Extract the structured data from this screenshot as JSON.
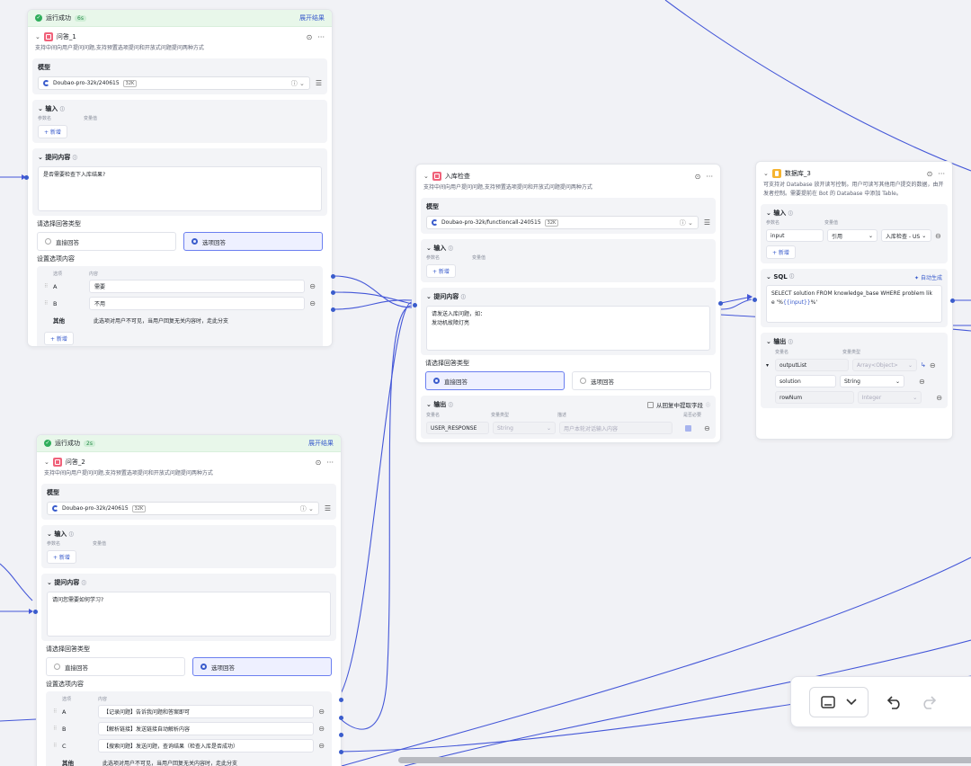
{
  "common": {
    "add_label": "+ 新增",
    "param_name_header": "参数名",
    "var_value_header": "变量值",
    "var_name_header": "变量名",
    "var_type_header": "变量类型",
    "model_label": "模型",
    "input_label": "输入",
    "prompt_label": "提问内容",
    "response_type_label": "请选择回答类型",
    "direct_answer": "直接回答",
    "option_answer": "选项回答",
    "option_content_label": "设置选项内容",
    "option_header": "选项",
    "content_header": "内容",
    "other_label": "其他",
    "other_desc": "此选项对用户不可见，当用户回复无关内容时，走此分支",
    "qa_desc": "支持中间向用户提问问题,支持预置选项提问和开放式问题提问两种方式"
  },
  "node_qa1": {
    "run_status": "运行成功",
    "run_time": "6s",
    "expand": "展开结果",
    "title": "问答_1",
    "model": "Doubao-pro-32k/240615",
    "model_ctx": "32K",
    "prompt": "是否需要检查下入库结果?",
    "options": [
      {
        "key": "A",
        "value": "需要"
      },
      {
        "key": "B",
        "value": "不用"
      }
    ]
  },
  "node_qa2": {
    "run_status": "运行成功",
    "run_time": "2s",
    "expand": "展开结果",
    "title": "问答_2",
    "model": "Doubao-pro-32k/240615",
    "model_ctx": "32K",
    "prompt": "请问您需要如何学习?",
    "options": [
      {
        "key": "A",
        "value": "【记录问题】告诉我问题和答案即可"
      },
      {
        "key": "B",
        "value": "【解析链接】发送链接自动解析内容"
      },
      {
        "key": "C",
        "value": "【搜索问题】发送问题，查询结果（检查入库是否成功）"
      }
    ]
  },
  "node_store": {
    "title": "入库检查",
    "model": "Doubao-pro-32k/functioncall-240515",
    "model_ctx": "32K",
    "prompt_line1": "请发送入库问题，如：",
    "prompt_line2": "发动机故障灯亮",
    "output_label": "输出",
    "extract_label": "从回复中提取字段",
    "desc_header": "描述",
    "required_header": "是否必要",
    "out_name": "USER_RESPONSE",
    "out_type": "String",
    "out_desc_placeholder": "用户本轮对话输入内容"
  },
  "node_db": {
    "title": "数据库_3",
    "desc": "可支持对 Database 放开读写控制。用户可读写其他用户提交的数据，由开发者控制。需要提前在 Bot 的 Database 中添加 Table。",
    "input_name": "input",
    "input_ref": "引用",
    "input_value": "入库检查 - US",
    "sql_label": "SQL",
    "auto_gen": "自动生成",
    "sql_line1": "SELECT solution FROM knowledge_base WHERE problem lik",
    "sql_line2_a": "e '%",
    "sql_var": "{{input}}",
    "sql_line2_b": "%'",
    "output_label": "输出",
    "outputs": [
      {
        "name": "outputList",
        "type": "Array<Object>"
      },
      {
        "name": "solution",
        "type": "String"
      },
      {
        "name": "rowNum",
        "type": "Integer"
      }
    ]
  },
  "toolbar": {
    "panel_icon": "panel-toggle-icon",
    "undo_icon": "undo-icon",
    "redo_icon": "redo-icon"
  },
  "colors": {
    "edge": "#4457d8",
    "accent": "#3a5ccc",
    "success": "#2fae5b"
  }
}
